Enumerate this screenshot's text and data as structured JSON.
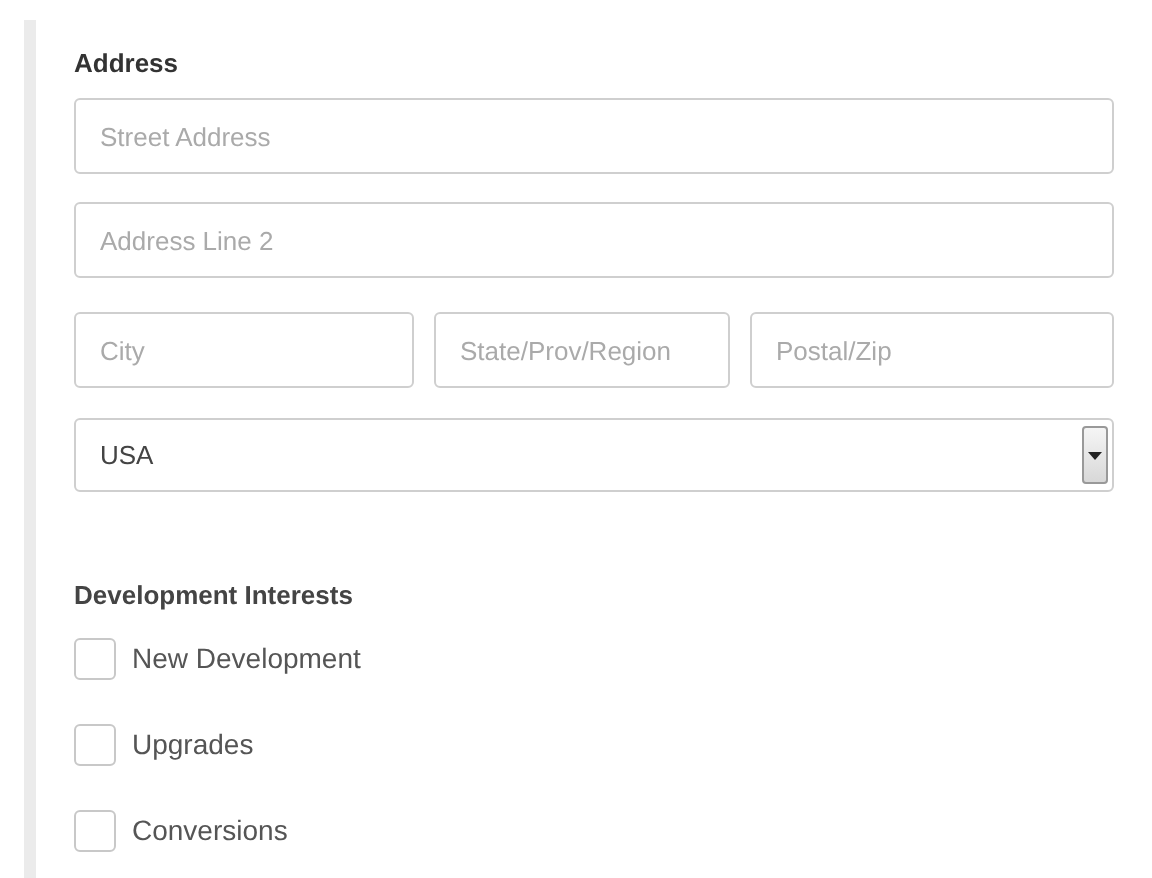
{
  "address": {
    "title": "Address",
    "street": {
      "placeholder": "Street Address"
    },
    "line2": {
      "placeholder": "Address Line 2"
    },
    "city": {
      "placeholder": "City"
    },
    "state": {
      "placeholder": "State/Prov/Region"
    },
    "postal": {
      "placeholder": "Postal/Zip"
    },
    "country": {
      "value": "USA"
    }
  },
  "interests": {
    "title": "Development Interests",
    "options": [
      {
        "label": "New Development",
        "checked": false
      },
      {
        "label": "Upgrades",
        "checked": false
      },
      {
        "label": "Conversions",
        "checked": false
      }
    ]
  }
}
